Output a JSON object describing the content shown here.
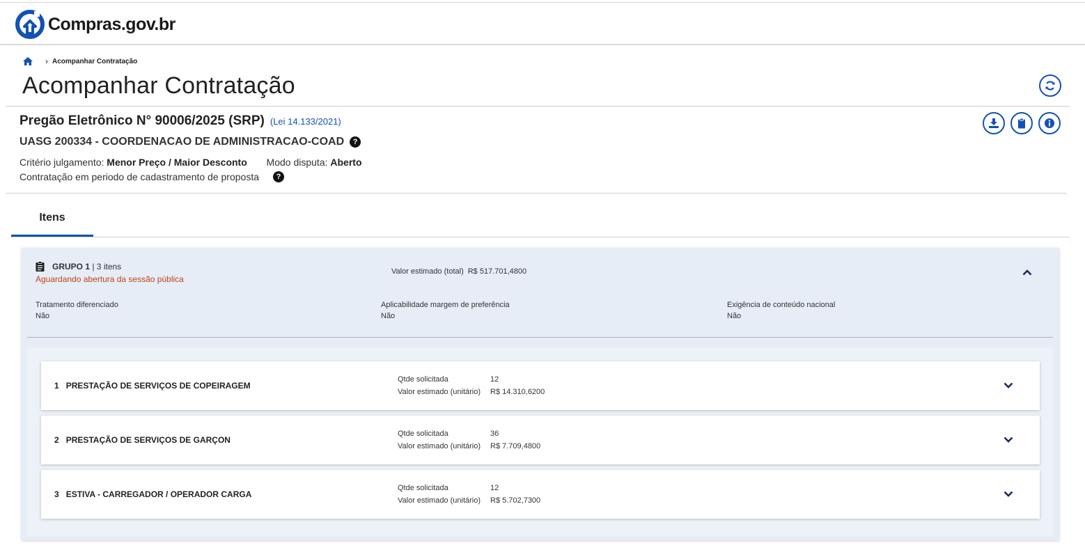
{
  "header": {
    "logo_text": "Compras.gov.br"
  },
  "breadcrumb": {
    "current": "Acompanhar Contratação"
  },
  "page": {
    "title": "Acompanhar Contratação"
  },
  "pregao": {
    "title": "Pregão Eletrônico N° 90006/2025 (SRP)",
    "lei": "(Lei 14.133/2021)",
    "uasg": "UASG 200334 - COORDENACAO DE ADMINISTRACAO-COAD",
    "criterio_label": "Critério julgamento:",
    "criterio_value": "Menor Preço / Maior Desconto",
    "modo_label": "Modo disputa:",
    "modo_value": "Aberto",
    "periodo": "Contratação em periodo de cadastramento de proposta"
  },
  "actions": {
    "refresh_icon": "refresh-icon",
    "download_icon": "download-icon",
    "clipboard_icon": "clipboard-icon",
    "info_icon": "info-icon"
  },
  "tabs": [
    {
      "label": "Itens"
    }
  ],
  "group": {
    "name": "GRUPO 1",
    "count": "| 3 itens",
    "status": "Aguardando abertura da sessão pública",
    "status_color": "#c0431b",
    "valor_label": "Valor estimado (total)",
    "valor_value": "R$ 517.701,4800",
    "attrs": [
      {
        "label": "Tratamento diferenciado",
        "value": "Não"
      },
      {
        "label": "Aplicabilidade margem de preferência",
        "value": "Não"
      },
      {
        "label": "Exigência de conteúdo nacional",
        "value": "Não"
      }
    ]
  },
  "items": [
    {
      "num": "1",
      "name": "PRESTAÇÃO DE SERVIÇOS DE COPEIRAGEM",
      "qtde_label": "Qtde solicitada",
      "qtde": "12",
      "valor_label": "Valor estimado (unitário)",
      "valor": "R$ 14.310,6200"
    },
    {
      "num": "2",
      "name": "PRESTAÇÃO DE SERVIÇOS DE GARÇON",
      "qtde_label": "Qtde solicitada",
      "qtde": "36",
      "valor_label": "Valor estimado (unitário)",
      "valor": "R$ 7.709,4800"
    },
    {
      "num": "3",
      "name": "ESTIVA - CARREGADOR / OPERADOR CARGA",
      "qtde_label": "Qtde solicitada",
      "qtde": "12",
      "valor_label": "Valor estimado (unitário)",
      "valor": "R$ 5.702,7300"
    }
  ],
  "colors": {
    "primary": "#1351b4",
    "group_bg": "#e6edf6"
  }
}
